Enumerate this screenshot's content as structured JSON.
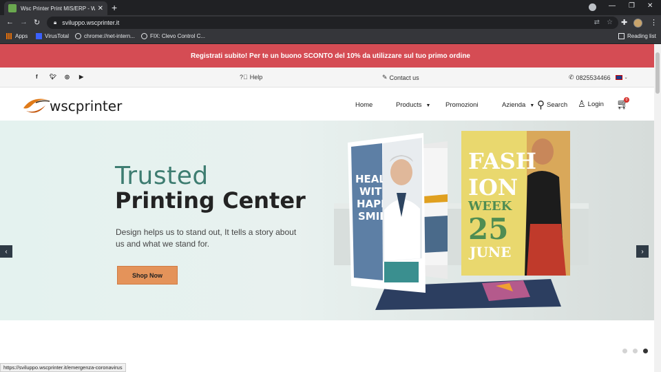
{
  "browser": {
    "tab_title": "Wsc Printer Print MIS/ERP - Web",
    "url": "sviluppo.wscprinter.it",
    "bookmarks": [
      "Apps",
      "VirusTotal",
      "chrome://net-intern...",
      "FIX: Clevo Control C..."
    ],
    "reading_list": "Reading list",
    "status_url": "https://sviluppo.wscprinter.it/emergenza-coronavirus"
  },
  "promo": {
    "text": "Registrati subito! Per te un buono SCONTO del 10% da utilizzare sul tuo primo ordine",
    "bg": "#d54c54"
  },
  "topbar": {
    "help": "Help",
    "contact": "Contact us",
    "phone": "0825534466"
  },
  "nav": {
    "home": "Home",
    "products": "Products",
    "promotions": "Promozioni",
    "company": "Azienda",
    "search": "Search",
    "login": "Login",
    "cart_count": "0"
  },
  "hero": {
    "title_1": "Trusted",
    "title_2": "Printing Center",
    "description": "Design helps us to stand out, It tells a story about us and what we stand for.",
    "cta": "Shop Now",
    "poster_health": [
      "HEALTH",
      "WITH",
      "HAPPY",
      "SMILE"
    ],
    "poster_fashion": [
      "FASH",
      "ION",
      "WEEK",
      "25",
      "JUNE"
    ]
  },
  "slider": {
    "active_slide": 3,
    "slides": 3
  }
}
